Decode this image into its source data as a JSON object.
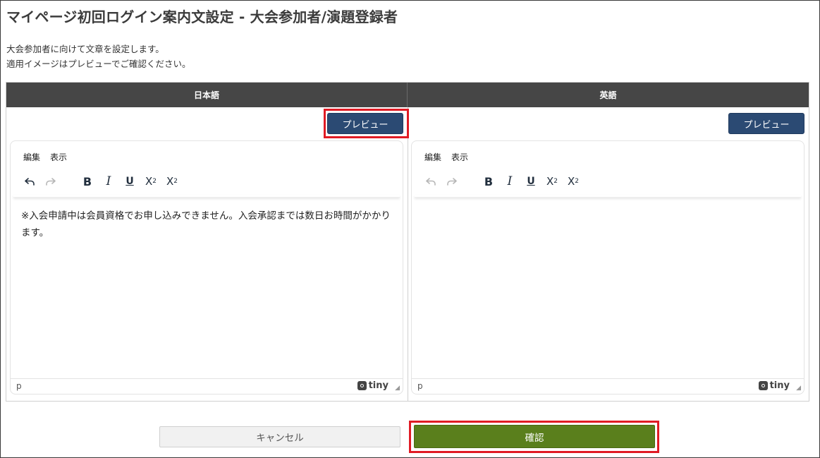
{
  "page": {
    "title": "マイページ初回ログイン案内文設定 - 大会参加者/演題登録者",
    "description_line1": "大会参加者に向けて文章を設定します。",
    "description_line2": "適用イメージはプレビューでご確認ください。"
  },
  "columns": {
    "japanese": {
      "header": "日本語",
      "preview_label": "プレビュー",
      "menu": [
        "編集",
        "表示"
      ],
      "content": "※入会申請中は会員資格でお申し込みできません。入会承認までは数日お時間がかかります。",
      "status_path": "p",
      "brand": "tiny"
    },
    "english": {
      "header": "英語",
      "preview_label": "プレビュー",
      "menu": [
        "編集",
        "表示"
      ],
      "content": "",
      "status_path": "p",
      "brand": "tiny"
    }
  },
  "toolbar": {
    "undo_icon": "undo-icon",
    "redo_icon": "redo-icon",
    "bold": "B",
    "italic": "I",
    "underline": "U",
    "subscript": "X",
    "subscript_mark": "2",
    "superscript": "X",
    "superscript_mark": "2"
  },
  "actions": {
    "cancel_label": "キャンセル",
    "confirm_label": "確認"
  },
  "colors": {
    "header_bg": "#464646",
    "preview_button": "#2b4a73",
    "confirm_button": "#5a7f1c",
    "highlight": "#e01b24"
  }
}
